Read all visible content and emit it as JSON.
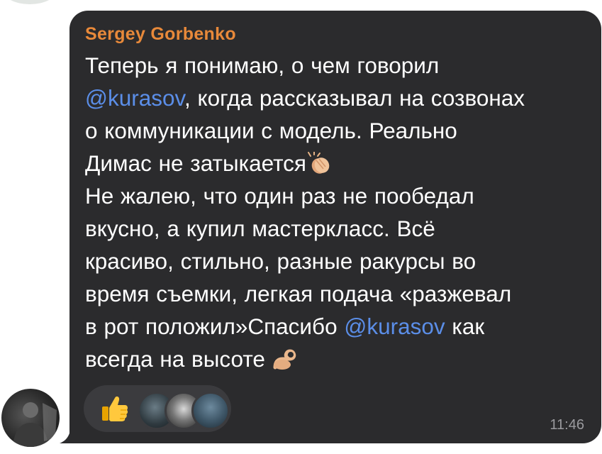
{
  "message": {
    "sender": "Sergey Gorbenko",
    "lines": [
      {
        "text": "Теперь я понимаю, о чем говорил"
      },
      {
        "mention": "@kurasov",
        "text": ", когда рассказывал на созвонах"
      },
      {
        "text": "о коммуникации с модель. Реально"
      },
      {
        "text": "Димас не затыкается",
        "emoji": "clapping-hands-icon"
      },
      {
        "text": "Не жалею, что один раз не пообедал"
      },
      {
        "text": "вкусно, а купил мастеркласс. Всё"
      },
      {
        "text": "красиво, стильно, разные ракурсы во"
      },
      {
        "text": "время съемки, легкая подача «разжевал"
      },
      {
        "text": "в рот положил»Спасибо ",
        "mention": "@kurasov",
        "text_after": " как"
      },
      {
        "text": "всегда на высоте ",
        "emoji": "ok-hand-icon"
      }
    ],
    "time": "11:46"
  },
  "reactions": {
    "emoji": "thumbs-up-icon",
    "reactor_count": 3
  },
  "colors": {
    "bubble_bg": "#2b2b2d",
    "sender": "#e8893a",
    "mention": "#5b8ee8",
    "text": "#ffffff",
    "time": "#9a9a9e"
  }
}
